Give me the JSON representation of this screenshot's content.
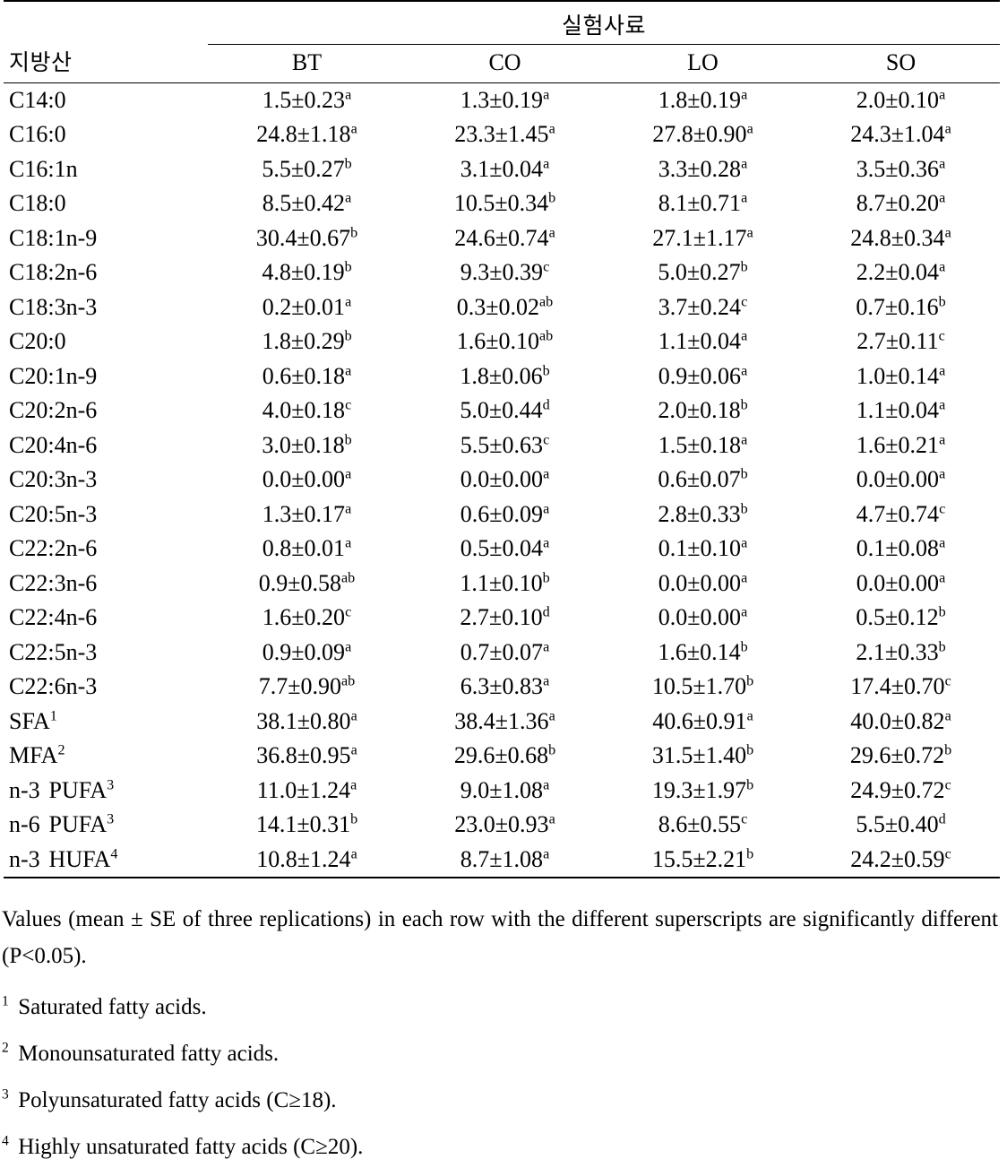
{
  "table": {
    "row_header_label": "지방산",
    "group_header": "실험사료",
    "columns": [
      "BT",
      "CO",
      "LO",
      "SO"
    ],
    "rows": [
      {
        "label": "C14:0",
        "sup": "",
        "values": [
          {
            "mean": "1.5",
            "sd": "0.23",
            "sup": "a"
          },
          {
            "mean": "1.3",
            "sd": "0.19",
            "sup": "a"
          },
          {
            "mean": "1.8",
            "sd": "0.19",
            "sup": "a"
          },
          {
            "mean": "2.0",
            "sd": "0.10",
            "sup": "a"
          }
        ]
      },
      {
        "label": "C16:0",
        "sup": "",
        "values": [
          {
            "mean": "24.8",
            "sd": "1.18",
            "sup": "a"
          },
          {
            "mean": "23.3",
            "sd": "1.45",
            "sup": "a"
          },
          {
            "mean": "27.8",
            "sd": "0.90",
            "sup": "a"
          },
          {
            "mean": "24.3",
            "sd": "1.04",
            "sup": "a"
          }
        ]
      },
      {
        "label": "C16:1n",
        "sup": "",
        "values": [
          {
            "mean": "5.5",
            "sd": "0.27",
            "sup": "b"
          },
          {
            "mean": "3.1",
            "sd": "0.04",
            "sup": "a"
          },
          {
            "mean": "3.3",
            "sd": "0.28",
            "sup": "a"
          },
          {
            "mean": "3.5",
            "sd": "0.36",
            "sup": "a"
          }
        ]
      },
      {
        "label": "C18:0",
        "sup": "",
        "values": [
          {
            "mean": "8.5",
            "sd": "0.42",
            "sup": "a"
          },
          {
            "mean": "10.5",
            "sd": "0.34",
            "sup": "b"
          },
          {
            "mean": "8.1",
            "sd": "0.71",
            "sup": "a"
          },
          {
            "mean": "8.7",
            "sd": "0.20",
            "sup": "a"
          }
        ]
      },
      {
        "label": "C18:1n-9",
        "sup": "",
        "values": [
          {
            "mean": "30.4",
            "sd": "0.67",
            "sup": "b"
          },
          {
            "mean": "24.6",
            "sd": "0.74",
            "sup": "a"
          },
          {
            "mean": "27.1",
            "sd": "1.17",
            "sup": "a"
          },
          {
            "mean": "24.8",
            "sd": "0.34",
            "sup": "a"
          }
        ]
      },
      {
        "label": "C18:2n-6",
        "sup": "",
        "values": [
          {
            "mean": "4.8",
            "sd": "0.19",
            "sup": "b"
          },
          {
            "mean": "9.3",
            "sd": "0.39",
            "sup": "c"
          },
          {
            "mean": "5.0",
            "sd": "0.27",
            "sup": "b"
          },
          {
            "mean": "2.2",
            "sd": "0.04",
            "sup": "a"
          }
        ]
      },
      {
        "label": "C18:3n-3",
        "sup": "",
        "values": [
          {
            "mean": "0.2",
            "sd": "0.01",
            "sup": "a"
          },
          {
            "mean": "0.3",
            "sd": "0.02",
            "sup": "ab"
          },
          {
            "mean": "3.7",
            "sd": "0.24",
            "sup": "c"
          },
          {
            "mean": "0.7",
            "sd": "0.16",
            "sup": "b"
          }
        ]
      },
      {
        "label": "C20:0",
        "sup": "",
        "values": [
          {
            "mean": "1.8",
            "sd": "0.29",
            "sup": "b"
          },
          {
            "mean": "1.6",
            "sd": "0.10",
            "sup": "ab"
          },
          {
            "mean": "1.1",
            "sd": "0.04",
            "sup": "a"
          },
          {
            "mean": "2.7",
            "sd": "0.11",
            "sup": "c"
          }
        ]
      },
      {
        "label": "C20:1n-9",
        "sup": "",
        "values": [
          {
            "mean": "0.6",
            "sd": "0.18",
            "sup": "a"
          },
          {
            "mean": "1.8",
            "sd": "0.06",
            "sup": "b"
          },
          {
            "mean": "0.9",
            "sd": "0.06",
            "sup": "a"
          },
          {
            "mean": "1.0",
            "sd": "0.14",
            "sup": "a"
          }
        ]
      },
      {
        "label": "C20:2n-6",
        "sup": "",
        "values": [
          {
            "mean": "4.0",
            "sd": "0.18",
            "sup": "c"
          },
          {
            "mean": "5.0",
            "sd": "0.44",
            "sup": "d"
          },
          {
            "mean": "2.0",
            "sd": "0.18",
            "sup": "b"
          },
          {
            "mean": "1.1",
            "sd": "0.04",
            "sup": "a"
          }
        ]
      },
      {
        "label": "C20:4n-6",
        "sup": "",
        "values": [
          {
            "mean": "3.0",
            "sd": "0.18",
            "sup": "b"
          },
          {
            "mean": "5.5",
            "sd": "0.63",
            "sup": "c"
          },
          {
            "mean": "1.5",
            "sd": "0.18",
            "sup": "a"
          },
          {
            "mean": "1.6",
            "sd": "0.21",
            "sup": "a"
          }
        ]
      },
      {
        "label": "C20:3n-3",
        "sup": "",
        "values": [
          {
            "mean": "0.0",
            "sd": "0.00",
            "sup": "a"
          },
          {
            "mean": "0.0",
            "sd": "0.00",
            "sup": "a"
          },
          {
            "mean": "0.6",
            "sd": "0.07",
            "sup": "b"
          },
          {
            "mean": "0.0",
            "sd": "0.00",
            "sup": "a"
          }
        ]
      },
      {
        "label": "C20:5n-3",
        "sup": "",
        "values": [
          {
            "mean": "1.3",
            "sd": "0.17",
            "sup": "a"
          },
          {
            "mean": "0.6",
            "sd": "0.09",
            "sup": "a"
          },
          {
            "mean": "2.8",
            "sd": "0.33",
            "sup": "b"
          },
          {
            "mean": "4.7",
            "sd": "0.74",
            "sup": "c"
          }
        ]
      },
      {
        "label": "C22:2n-6",
        "sup": "",
        "values": [
          {
            "mean": "0.8",
            "sd": "0.01",
            "sup": "a"
          },
          {
            "mean": "0.5",
            "sd": "0.04",
            "sup": "a"
          },
          {
            "mean": "0.1",
            "sd": "0.10",
            "sup": "a"
          },
          {
            "mean": "0.1",
            "sd": "0.08",
            "sup": "a"
          }
        ]
      },
      {
        "label": "C22:3n-6",
        "sup": "",
        "values": [
          {
            "mean": "0.9",
            "sd": "0.58",
            "sup": "ab"
          },
          {
            "mean": "1.1",
            "sd": "0.10",
            "sup": "b"
          },
          {
            "mean": "0.0",
            "sd": "0.00",
            "sup": "a"
          },
          {
            "mean": "0.0",
            "sd": "0.00",
            "sup": "a"
          }
        ]
      },
      {
        "label": "C22:4n-6",
        "sup": "",
        "values": [
          {
            "mean": "1.6",
            "sd": "0.20",
            "sup": "c"
          },
          {
            "mean": "2.7",
            "sd": "0.10",
            "sup": "d"
          },
          {
            "mean": "0.0",
            "sd": "0.00",
            "sup": "a"
          },
          {
            "mean": "0.5",
            "sd": "0.12",
            "sup": "b"
          }
        ]
      },
      {
        "label": "C22:5n-3",
        "sup": "",
        "values": [
          {
            "mean": "0.9",
            "sd": "0.09",
            "sup": "a"
          },
          {
            "mean": "0.7",
            "sd": "0.07",
            "sup": "a"
          },
          {
            "mean": "1.6",
            "sd": "0.14",
            "sup": "b"
          },
          {
            "mean": "2.1",
            "sd": "0.33",
            "sup": "b"
          }
        ]
      },
      {
        "label": "C22:6n-3",
        "sup": "",
        "values": [
          {
            "mean": "7.7",
            "sd": "0.90",
            "sup": "ab"
          },
          {
            "mean": "6.3",
            "sd": "0.83",
            "sup": "a"
          },
          {
            "mean": "10.5",
            "sd": "1.70",
            "sup": "b"
          },
          {
            "mean": "17.4",
            "sd": "0.70",
            "sup": "c"
          }
        ]
      },
      {
        "label": "SFA",
        "sup": "1",
        "values": [
          {
            "mean": "38.1",
            "sd": "0.80",
            "sup": "a"
          },
          {
            "mean": "38.4",
            "sd": "1.36",
            "sup": "a"
          },
          {
            "mean": "40.6",
            "sd": "0.91",
            "sup": "a"
          },
          {
            "mean": "40.0",
            "sd": "0.82",
            "sup": "a"
          }
        ]
      },
      {
        "label": "MFA",
        "sup": "2",
        "values": [
          {
            "mean": "36.8",
            "sd": "0.95",
            "sup": "a"
          },
          {
            "mean": "29.6",
            "sd": "0.68",
            "sup": "b"
          },
          {
            "mean": "31.5",
            "sd": "1.40",
            "sup": "b"
          },
          {
            "mean": "29.6",
            "sd": "0.72",
            "sup": "b"
          }
        ]
      },
      {
        "label": "n-3 PUFA",
        "sup": "3",
        "values": [
          {
            "mean": "11.0",
            "sd": "1.24",
            "sup": "a"
          },
          {
            "mean": "9.0",
            "sd": "1.08",
            "sup": "a"
          },
          {
            "mean": "19.3",
            "sd": "1.97",
            "sup": "b"
          },
          {
            "mean": "24.9",
            "sd": "0.72",
            "sup": "c"
          }
        ]
      },
      {
        "label": "n-6 PUFA",
        "sup": "3",
        "values": [
          {
            "mean": "14.1",
            "sd": "0.31",
            "sup": "b"
          },
          {
            "mean": "23.0",
            "sd": "0.93",
            "sup": "a"
          },
          {
            "mean": "8.6",
            "sd": "0.55",
            "sup": "c"
          },
          {
            "mean": "5.5",
            "sd": "0.40",
            "sup": "d"
          }
        ]
      },
      {
        "label": "n-3 HUFA",
        "sup": "4",
        "values": [
          {
            "mean": "10.8",
            "sd": "1.24",
            "sup": "a"
          },
          {
            "mean": "8.7",
            "sd": "1.08",
            "sup": "a"
          },
          {
            "mean": "15.5",
            "sd": "2.21",
            "sup": "b"
          },
          {
            "mean": "24.2",
            "sd": "0.59",
            "sup": "c"
          }
        ]
      }
    ]
  },
  "notes": {
    "main": "Values (mean ± SE of three replications) in each row with the different superscripts are significantly different (P<0.05).",
    "items": [
      {
        "marker": "1",
        "text": "Saturated fatty acids."
      },
      {
        "marker": "2",
        "text": "Monounsaturated fatty acids."
      },
      {
        "marker": "3",
        "text": "Polyunsaturated fatty acids (C≥18)."
      },
      {
        "marker": "4",
        "text": "Highly unsaturated fatty acids (C≥20)."
      }
    ]
  }
}
